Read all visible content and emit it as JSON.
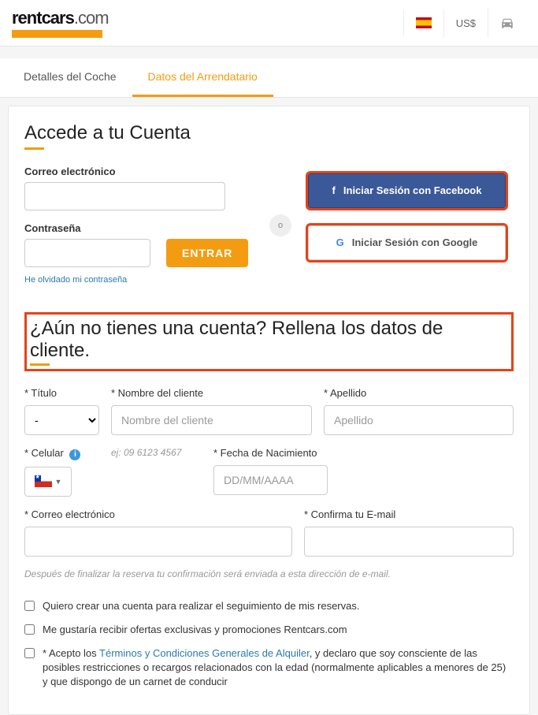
{
  "header": {
    "logo_rent": "rent",
    "logo_cars": "cars",
    "logo_com": ".com",
    "currency": "US$"
  },
  "tabs": {
    "details": "Detalles del Coche",
    "renter": "Datos del Arrendatario"
  },
  "login": {
    "title": "Accede a tu Cuenta",
    "email_label": "Correo electrónico",
    "password_label": "Contraseña",
    "enter_button": "ENTRAR",
    "forgot": "He olvidado mi contraseña",
    "or": "o",
    "facebook": "Iniciar Sesión con Facebook",
    "google": "Iniciar Sesión con Google"
  },
  "signup": {
    "title": "¿Aún no tienes una cuenta? Rellena los datos de cliente.",
    "title_label": "* Título",
    "title_value": "-",
    "name_label": "* Nombre del cliente",
    "name_placeholder": "Nombre del cliente",
    "surname_label": "* Apellido",
    "surname_placeholder": "Apellido",
    "mobile_label": "* Celular",
    "mobile_hint": "ej: 09 6123 4567",
    "dob_label": "* Fecha de Nacimiento",
    "dob_placeholder": "DD/MM/AAAA",
    "email2_label": "* Correo electrónico",
    "confirm_email_label": "* Confirma tu E-mail",
    "note": "Después de finalizar la reserva tu confirmación será enviada a esta dirección de e-mail.",
    "cb_create": "Quiero crear una cuenta para realizar el seguimiento de mis reservas.",
    "cb_offers": "Me gustaría recibir ofertas exclusivas y promociones Rentcars.com",
    "cb_terms_prefix": "* Acepto los ",
    "terms_link": "Términos y Condiciones Generales de Alquiler",
    "cb_terms_suffix": ", y declaro que soy consciente de las posibles restricciones o recargos relacionados con la edad (normalmente aplicables a menores de 25) y que dispongo de un carnet de conducir"
  }
}
